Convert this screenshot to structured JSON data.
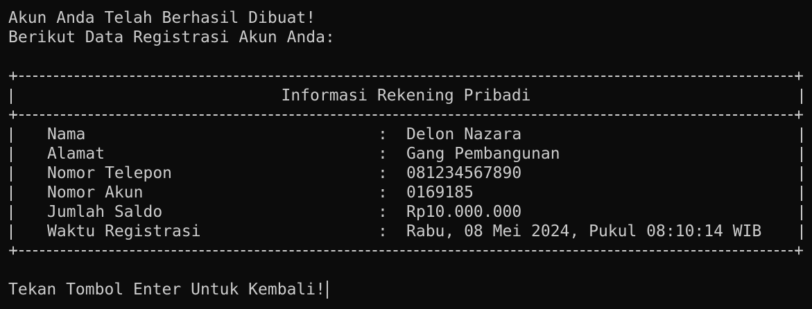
{
  "header": {
    "line1": "Akun Anda Telah Berhasil Dibuat!",
    "line2": "Berikut Data Registrasi Akun Anda:"
  },
  "table": {
    "title": "Informasi Rekening Pribadi",
    "rows": [
      {
        "label": "Nama",
        "value": "Delon Nazara"
      },
      {
        "label": "Alamat",
        "value": "Gang Pembangunan"
      },
      {
        "label": "Nomor Telepon",
        "value": "081234567890"
      },
      {
        "label": "Nomor Akun",
        "value": "0169185"
      },
      {
        "label": "Jumlah Saldo",
        "value": "Rp10.000.000"
      },
      {
        "label": "Waktu Registrasi",
        "value": "Rabu, 08 Mei 2024, Pukul 08:10:14 WIB"
      }
    ],
    "separator": ":",
    "corner": "+"
  },
  "footer": {
    "prompt": "Tekan Tombol Enter Untuk Kembali!"
  },
  "colors": {
    "background": "#0c0c0c",
    "foreground": "#cccccc"
  }
}
